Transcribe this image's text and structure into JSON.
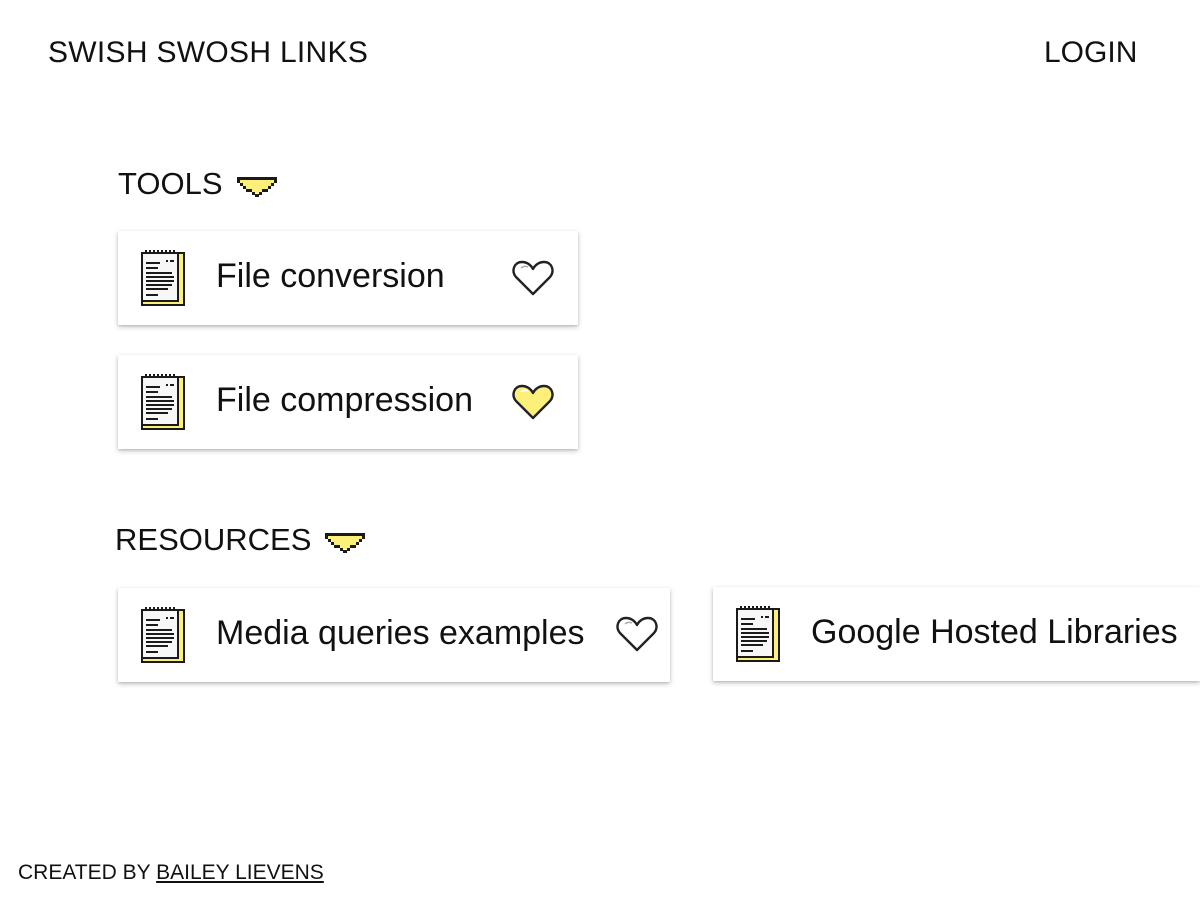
{
  "header": {
    "title": "SWISH SWOSH LINKS",
    "login_label": "LOGIN"
  },
  "sections": [
    {
      "title": "TOOLS",
      "toggle_icon": "chevron-down-pixel-icon",
      "links": [
        {
          "label": "File conversion",
          "icon": "document-icon",
          "favorited": false
        },
        {
          "label": "File compression",
          "icon": "document-icon",
          "favorited": true
        }
      ]
    },
    {
      "title": "RESOURCES",
      "toggle_icon": "chevron-down-pixel-icon",
      "links": [
        {
          "label": "Media queries examples",
          "icon": "document-icon",
          "favorited": false
        },
        {
          "label": "Google Hosted Libraries",
          "icon": "document-icon"
        }
      ]
    }
  ],
  "footer": {
    "prefix": "CREATED BY",
    "author": "BAILEY LIEVENS"
  },
  "colors": {
    "accent_yellow": "#fdf07a",
    "text": "#111111",
    "background": "#ffffff"
  }
}
